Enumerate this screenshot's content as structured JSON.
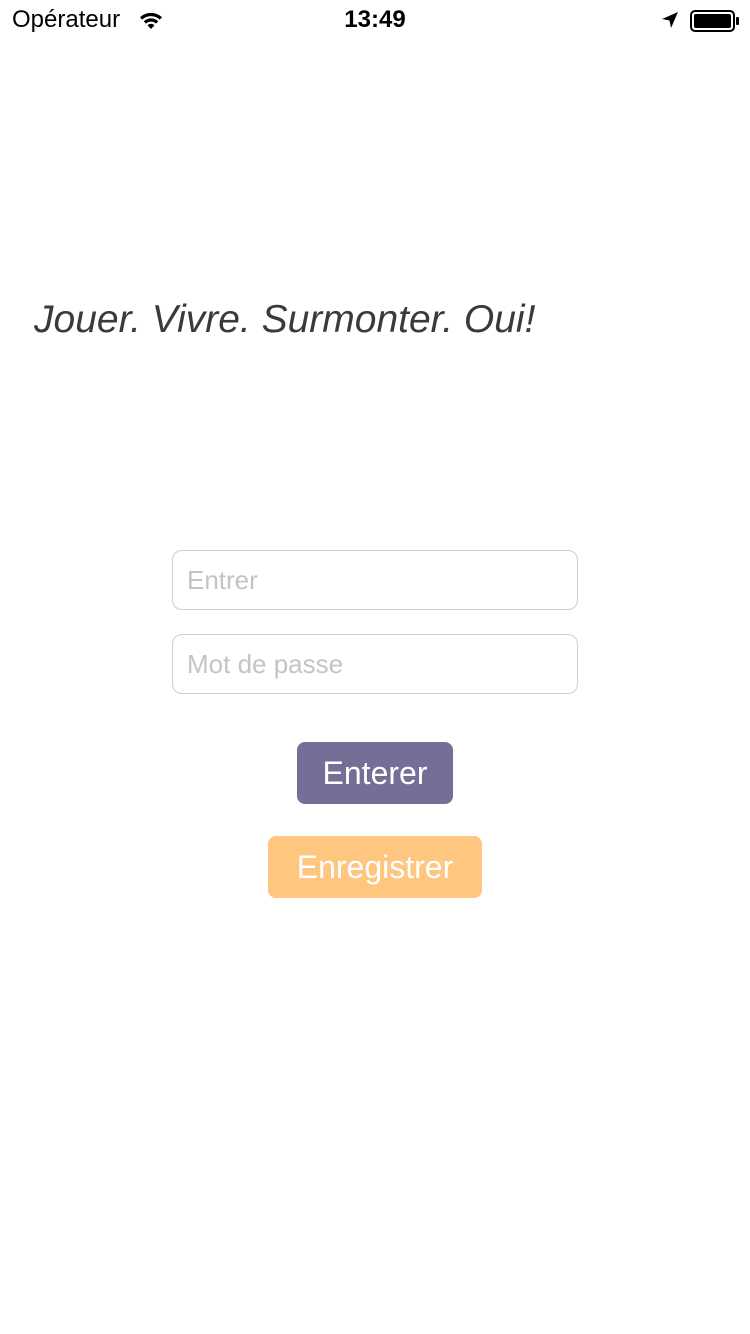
{
  "status_bar": {
    "carrier": "Opérateur",
    "time": "13:49",
    "icons": {
      "wifi": "wifi-icon",
      "location": "location-arrow-icon",
      "battery": "battery-icon"
    }
  },
  "tagline": "Jouer. Vivre. Surmonter. Oui!",
  "form": {
    "login": {
      "value": "",
      "placeholder": "Entrer"
    },
    "password": {
      "value": "",
      "placeholder": "Mot de passe"
    }
  },
  "buttons": {
    "enter_label": "Enterer",
    "register_label": "Enregistrer"
  },
  "colors": {
    "enter_button": "#776e97",
    "register_button": "#fec67f",
    "tagline_text": "#3a3a3a",
    "field_border": "#cfcfcf",
    "placeholder": "#c4c4c8"
  }
}
